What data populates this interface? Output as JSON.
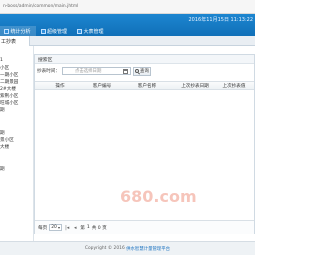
{
  "browser": {
    "url": "n-boss/admin/common/main.jhtml"
  },
  "header": {
    "datetime": "2016年11月15日 11:13:22",
    "nav": [
      {
        "label": "统计分析",
        "icon": "chart-icon"
      },
      {
        "label": "超级管理",
        "icon": "admin-icon"
      },
      {
        "label": "大表管理",
        "icon": "meter-icon"
      }
    ]
  },
  "tabs": {
    "active_label": "工抄表"
  },
  "sidebar": {
    "items": [
      {
        "label": "1"
      },
      {
        "label": "小区"
      },
      {
        "label": "一期小区"
      },
      {
        "label": "二期景园"
      },
      {
        "label": "2#大楼"
      },
      {
        "label": "紫荆小区"
      },
      {
        "label": "旺城小区"
      },
      {
        "label": "期"
      },
      {
        "label": "期"
      },
      {
        "label": "景小区"
      },
      {
        "label": "大楼"
      },
      {
        "label": "期"
      }
    ]
  },
  "panel": {
    "title": "搜索区",
    "search": {
      "label": "抄表时间：",
      "placeholder": "点击选择日期",
      "button_label": "查询"
    },
    "columns": {
      "op": "操作",
      "code": "客户编号",
      "name": "客户名称",
      "last_date": "上次抄表日期",
      "last_value": "上次抄表值"
    },
    "pager": {
      "page_size_label": "每页",
      "page_size": "20",
      "page_info": "第",
      "page_number": "1",
      "total_pages": "共 0 页"
    }
  },
  "footer": {
    "text": "Copyright © 2016",
    "brand": "供水智慧计量管理平台"
  },
  "watermark": {
    "text": "680.com"
  }
}
